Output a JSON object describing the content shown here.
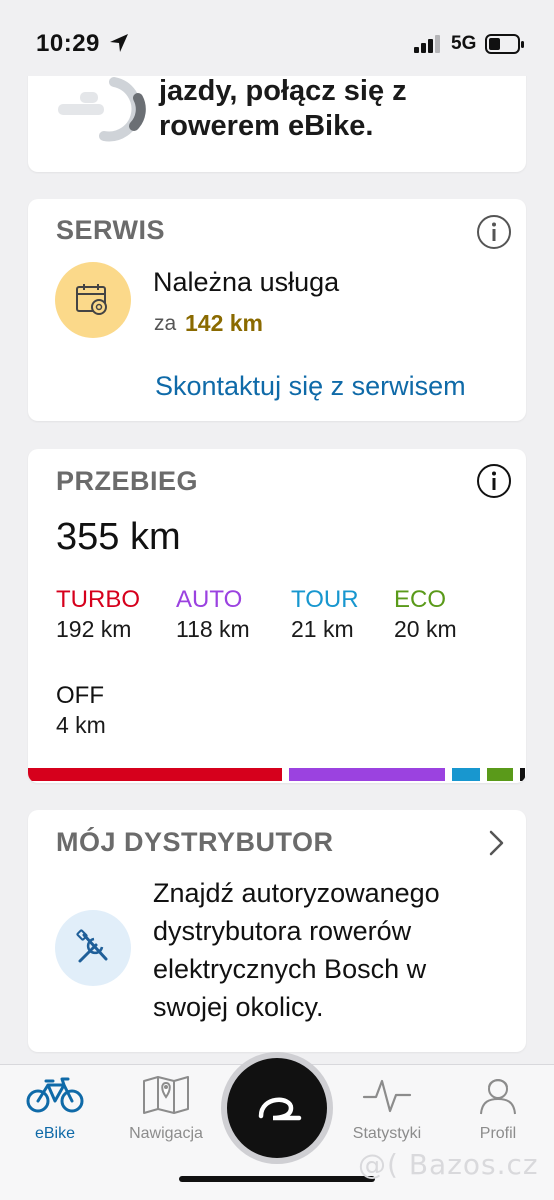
{
  "status_bar": {
    "time": "10:29",
    "network": "5G",
    "icons": [
      "location-arrow-icon",
      "signal-icon",
      "battery-icon"
    ]
  },
  "connect_card": {
    "text": "jazdy, połącz się z rowerem eBike."
  },
  "service": {
    "title": "SERWIS",
    "item_title": "Należna usługa",
    "prefix": "za",
    "distance": "142 km",
    "link": "Skontaktuj się z serwisem",
    "icon": "calendar-gear-icon"
  },
  "mileage": {
    "title": "PRZEBIEG",
    "total": "355 km",
    "modes": [
      {
        "name": "TURBO",
        "value": "192 km",
        "color": "#d6001c",
        "km": 192
      },
      {
        "name": "AUTO",
        "value": "118 km",
        "color": "#9b42e0",
        "km": 118
      },
      {
        "name": "TOUR",
        "value": "21 km",
        "color": "#1897cf",
        "km": 21
      },
      {
        "name": "ECO",
        "value": "20 km",
        "color": "#5a9a1a",
        "km": 20
      },
      {
        "name": "OFF",
        "value": "4 km",
        "color": "#111111",
        "km": 4
      }
    ]
  },
  "dealer": {
    "title": "MÓJ DYSTRYBUTOR",
    "text": "Znajdź autoryzowanego dystrybutora rowerów elektrycznych Bosch w swojej okolicy.",
    "icon": "tools-icon"
  },
  "tabs": [
    {
      "label": "eBike",
      "icon": "bike-icon",
      "active": true
    },
    {
      "label": "Nawigacja",
      "icon": "map-icon",
      "active": false
    },
    {
      "label": "Statystyki",
      "icon": "activity-icon",
      "active": false
    },
    {
      "label": "Profil",
      "icon": "profile-icon",
      "active": false
    }
  ],
  "watermark": "@( Bazos.cz",
  "colors": {
    "accent": "#0f6aa8",
    "service_circle": "#fbd98a",
    "dealer_circle": "#e1eef9",
    "distance_highlight": "#8a6a00"
  }
}
